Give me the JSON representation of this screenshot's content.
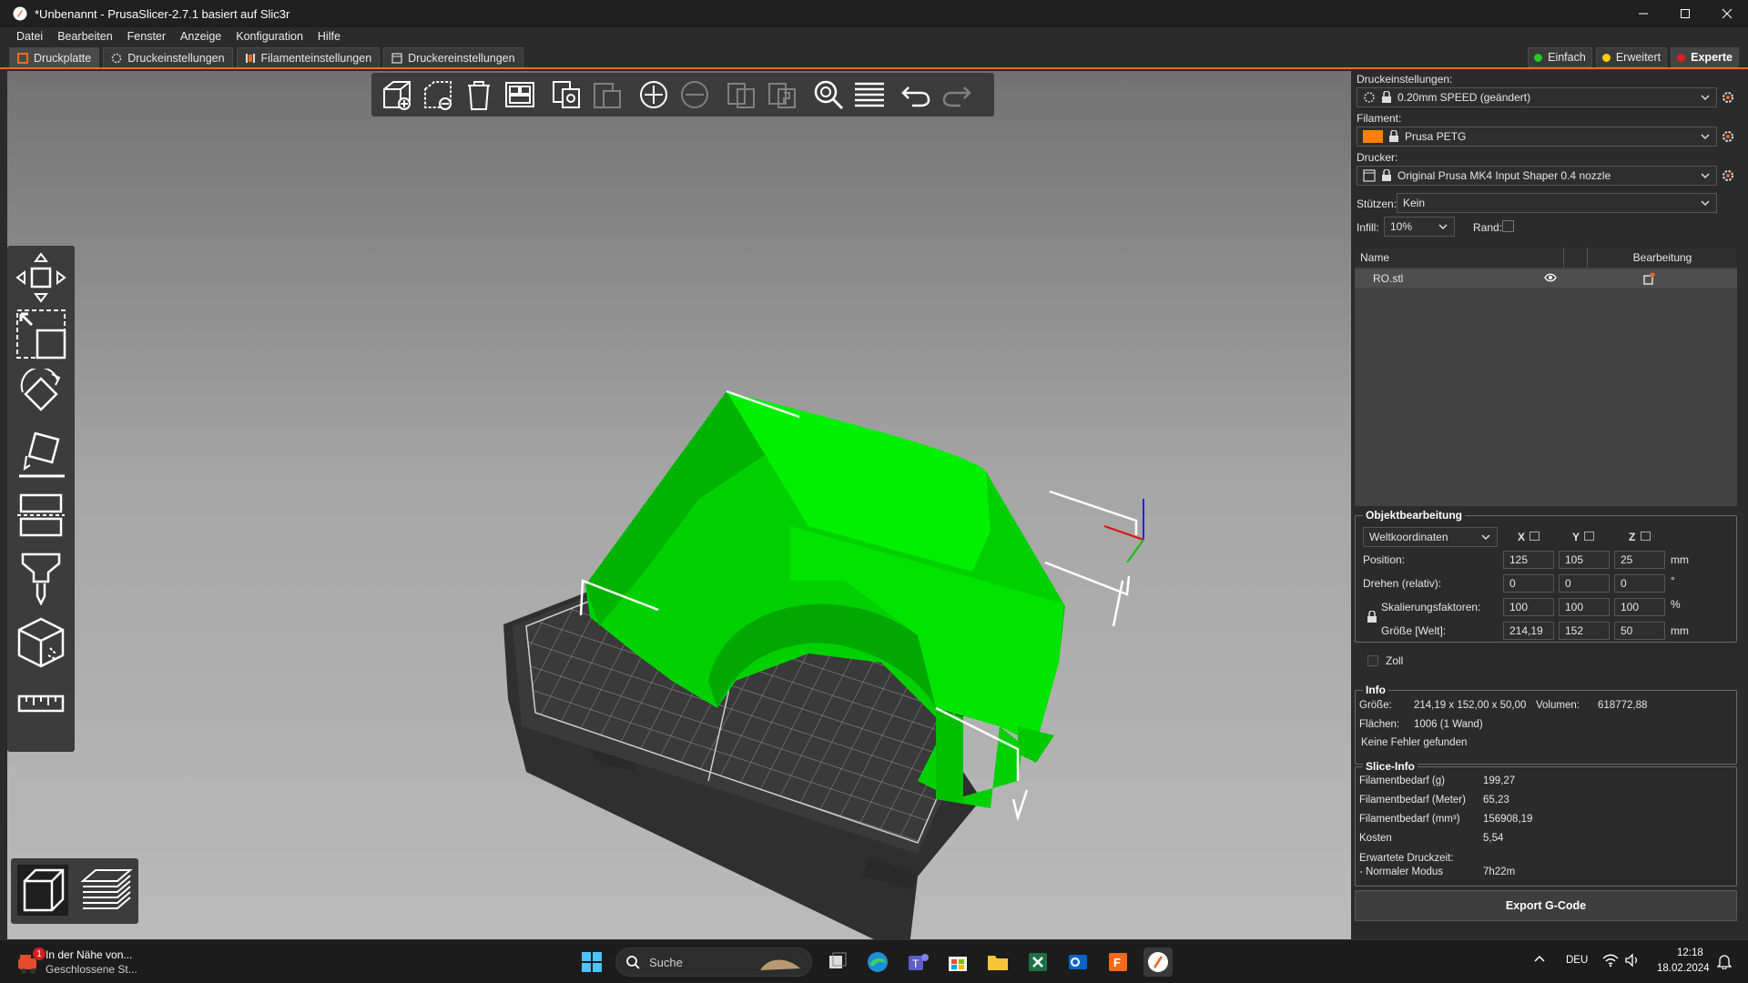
{
  "window": {
    "title": "*Unbenannt - PrusaSlicer-2.7.1 basiert auf Slic3r"
  },
  "menu": [
    "Datei",
    "Bearbeiten",
    "Fenster",
    "Anzeige",
    "Konfiguration",
    "Hilfe"
  ],
  "tabs": [
    {
      "label": "Druckplatte",
      "icon": "plater-icon",
      "active": true
    },
    {
      "label": "Druckeinstellungen",
      "icon": "cog-icon",
      "active": false
    },
    {
      "label": "Filamenteinstellungen",
      "icon": "spool-icon",
      "active": false
    },
    {
      "label": "Druckereinstellungen",
      "icon": "printer-icon",
      "active": false
    }
  ],
  "modes": [
    {
      "label": "Einfach",
      "color": "#22cc22",
      "active": false
    },
    {
      "label": "Erweitert",
      "color": "#ffcc00",
      "active": false
    },
    {
      "label": "Experte",
      "color": "#e02020",
      "active": true
    }
  ],
  "sidebar": {
    "print_settings_label": "Druckeinstellungen:",
    "print_settings_value": "0.20mm SPEED (geändert)",
    "filament_label": "Filament:",
    "filament_value": "Prusa PETG",
    "filament_color": "#ff7f00",
    "printer_label": "Drucker:",
    "printer_value": "Original Prusa MK4 Input Shaper 0.4 nozzle",
    "supports_label": "Stützen:",
    "supports_value": "Kein",
    "infill_label": "Infill:",
    "infill_value": "10%",
    "brim_label": "Rand:",
    "brim_checked": false
  },
  "object_list": {
    "col_name": "Name",
    "col_editing": "Bearbeitung",
    "rows": [
      {
        "name": "RO.stl"
      }
    ]
  },
  "object_manipulation": {
    "title": "Objektbearbeitung",
    "coordinate_system": "Weltkoordinaten",
    "axis_x": "X",
    "axis_y": "Y",
    "axis_z": "Z",
    "position_label": "Position:",
    "position": [
      "125",
      "105",
      "25"
    ],
    "position_unit": "mm",
    "rotation_label": "Drehen (relativ):",
    "rotation": [
      "0",
      "0",
      "0"
    ],
    "rotation_unit": "°",
    "scale_label": "Skalierungsfaktoren:",
    "scale": [
      "100",
      "100",
      "100"
    ],
    "scale_unit": "%",
    "size_label": "Größe [Welt]:",
    "size": [
      "214,19",
      "152",
      "50"
    ],
    "size_unit": "mm",
    "inches_label": "Zoll"
  },
  "info": {
    "title": "Info",
    "size_label": "Größe:",
    "size_value": "214,19 x 152,00 x 50,00",
    "volume_label": "Volumen:",
    "volume_value": "618772,88",
    "facets_label": "Flächen:",
    "facets_value": "1006 (1 Wand)",
    "errors": "Keine Fehler gefunden"
  },
  "slice_info": {
    "title": "Slice-Info",
    "rows": [
      {
        "label": "Filamentbedarf (g)",
        "value": "199,27"
      },
      {
        "label": "Filamentbedarf (Meter)",
        "value": "65,23"
      },
      {
        "label": "Filamentbedarf (mm³)",
        "value": "156908,19"
      },
      {
        "label": "Kosten",
        "value": "5,54"
      }
    ],
    "time_label": "Erwartete Druckzeit:",
    "mode_label": "- Normaler Modus",
    "mode_value": "7h22m"
  },
  "export_button": "Export G-Code",
  "taskbar": {
    "weather_line1": "In der Nähe von...",
    "weather_line2": "Geschlossene St...",
    "weather_badge": "1",
    "search_placeholder": "Suche",
    "language": "DEU",
    "time": "12:18",
    "date": "18.02.2024"
  },
  "colors": {
    "accent": "#ed6b21",
    "model": "#00e000",
    "bed": "#3a3a3a"
  }
}
